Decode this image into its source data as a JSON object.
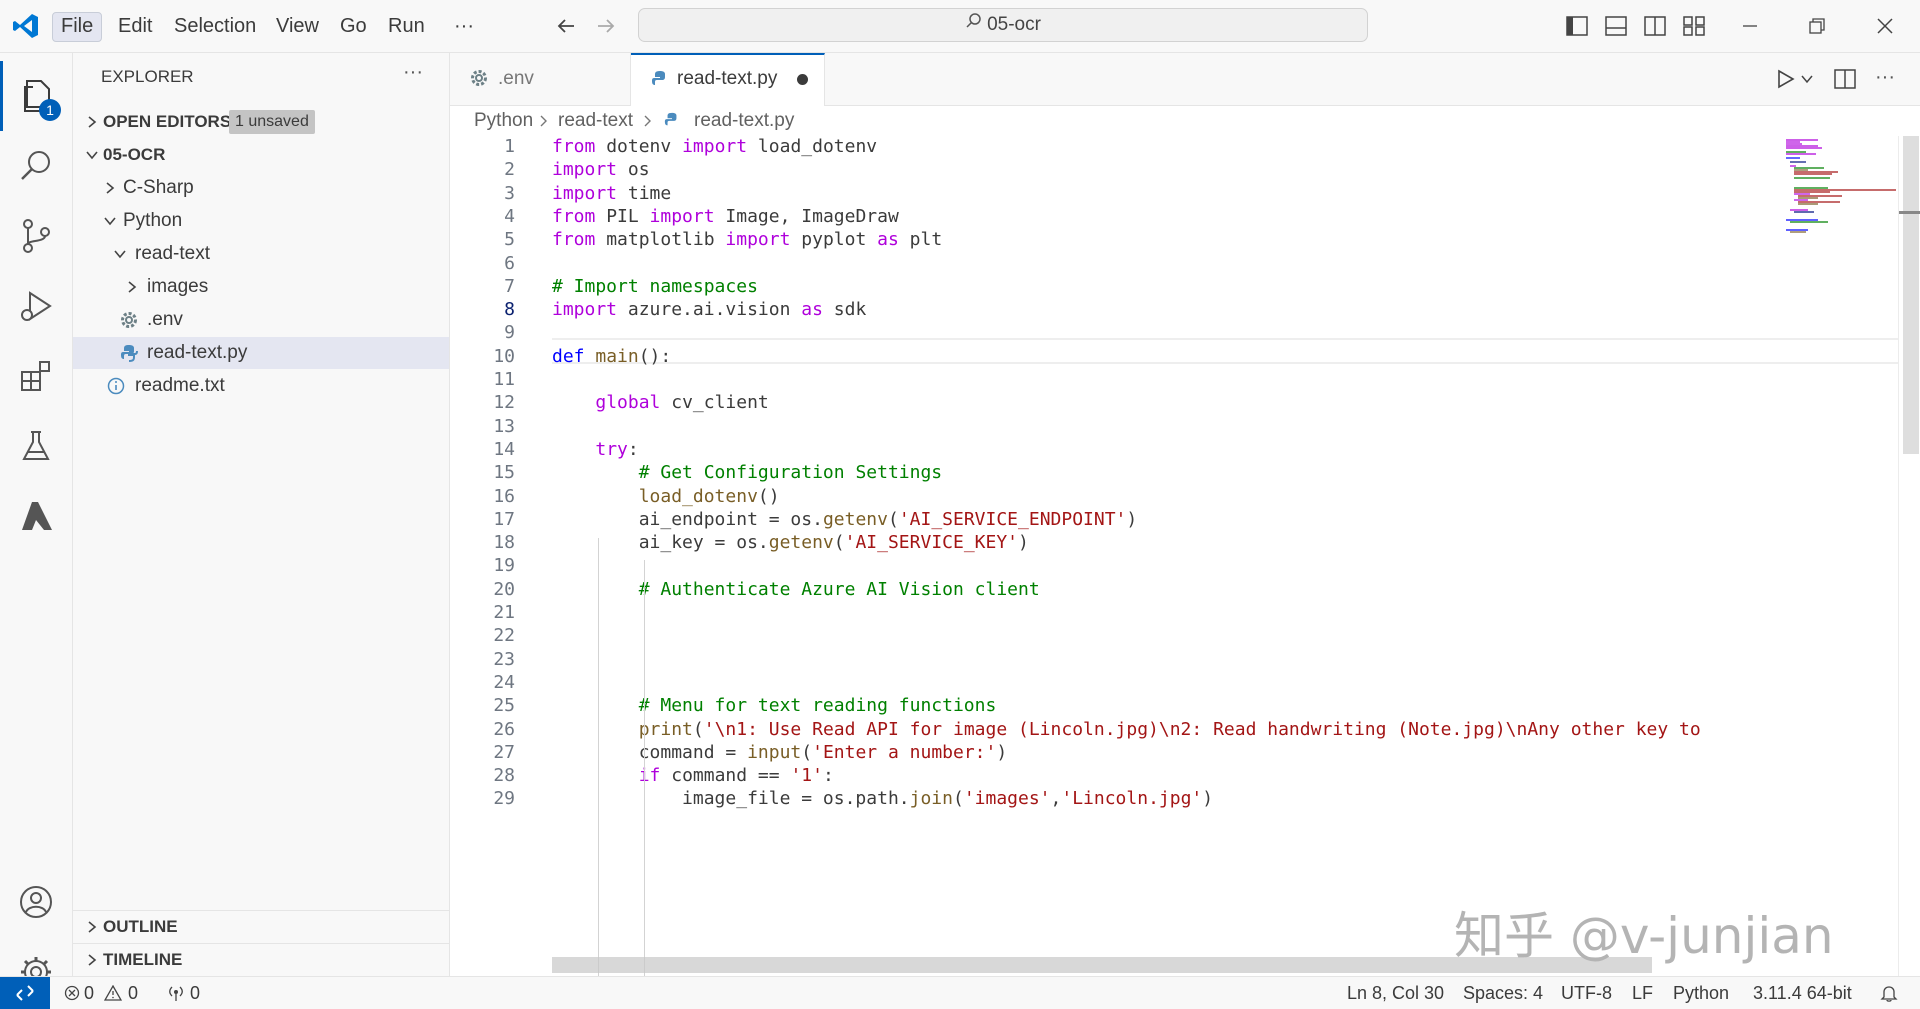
{
  "titlebar": {
    "menu": [
      "File",
      "Edit",
      "Selection",
      "View",
      "Go",
      "Run"
    ],
    "more": "···",
    "search": "05-ocr"
  },
  "activity": {
    "badge": "1"
  },
  "sidebar": {
    "title": "EXPLORER",
    "more": "···",
    "open_editors": "OPEN EDITORS",
    "unsaved": "1 unsaved",
    "root": "05-OCR",
    "items": [
      "C-Sharp",
      "Python",
      "read-text",
      "images",
      ".env",
      "read-text.py",
      "readme.txt"
    ],
    "outline": "OUTLINE",
    "timeline": "TIMELINE"
  },
  "tabs": [
    {
      "label": ".env"
    },
    {
      "label": "read-text.py"
    }
  ],
  "breadcrumb": [
    "Python",
    "read-text",
    "read-text.py"
  ],
  "code_lines": [
    "from dotenv import load_dotenv",
    "import os",
    "import time",
    "from PIL import Image, ImageDraw",
    "from matplotlib import pyplot as plt",
    "",
    "# Import namespaces",
    "import azure.ai.vision as sdk",
    "",
    "def main():",
    "",
    "    global cv_client",
    "",
    "    try:",
    "        # Get Configuration Settings",
    "        load_dotenv()",
    "        ai_endpoint = os.getenv('AI_SERVICE_ENDPOINT')",
    "        ai_key = os.getenv('AI_SERVICE_KEY')",
    "",
    "        # Authenticate Azure AI Vision client",
    "",
    "",
    "",
    "",
    "        # Menu for text reading functions",
    "        print('\\n1: Use Read API for image (Lincoln.jpg)\\n2: Read handwriting (Note.jpg)\\nAny other key to",
    "        command = input('Enter a number:')",
    "        if command == '1':",
    "            image_file = os.path.join('images','Lincoln.jpg')"
  ],
  "watermark": "知乎 @v-junjian",
  "status": {
    "errors": "0",
    "warnings": "0",
    "ports": "0",
    "position": "Ln 8, Col 30",
    "spaces": "Spaces: 4",
    "encoding": "UTF-8",
    "eol": "LF",
    "language": "Python",
    "interpreter": "3.11.4 64-bit"
  }
}
